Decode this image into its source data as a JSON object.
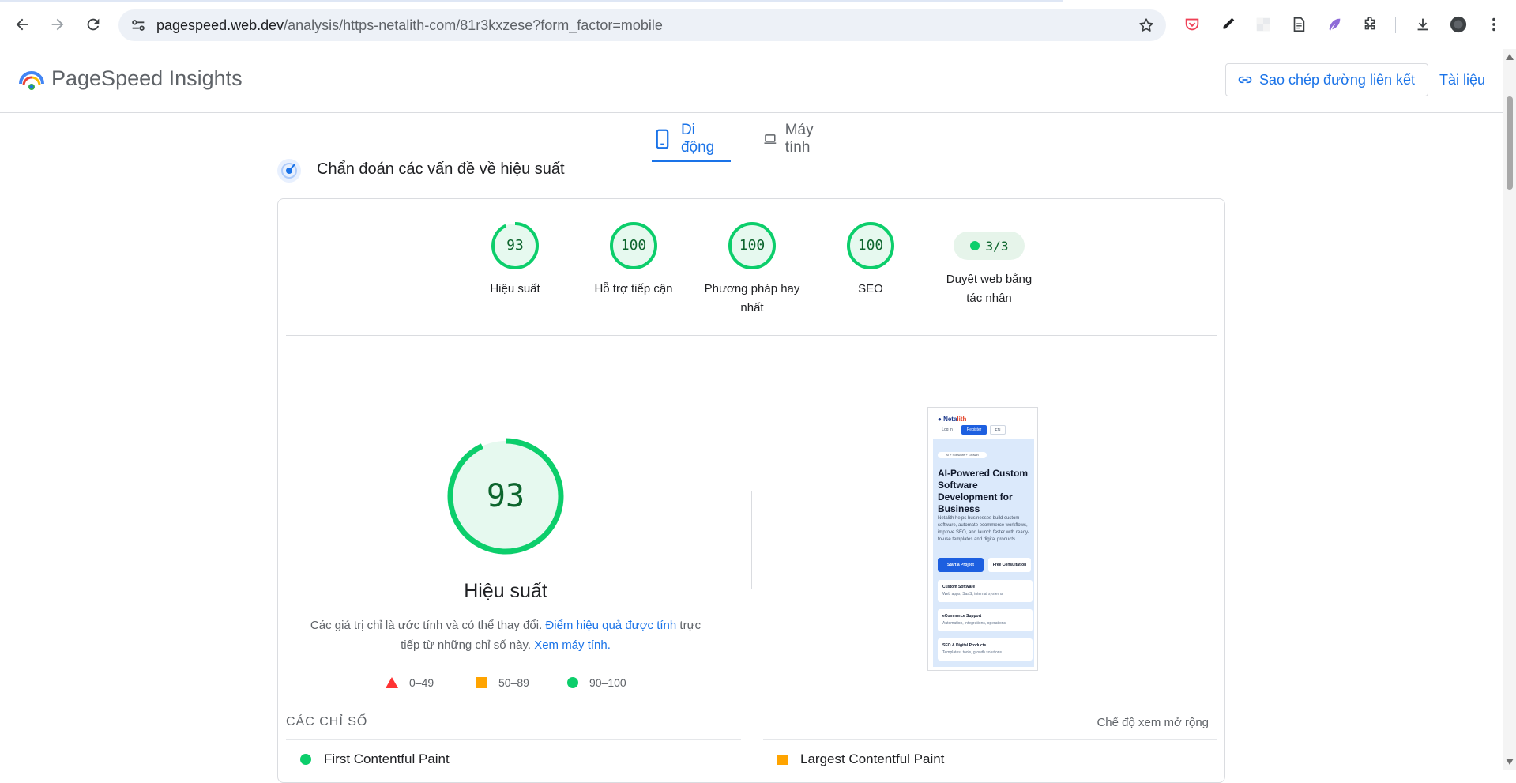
{
  "browser": {
    "url_host": "pagespeed.web.dev",
    "url_path": "/analysis/https-netalith-com/81r3kxzese?form_factor=mobile"
  },
  "header": {
    "title": "PageSpeed Insights",
    "copy_link_label": "Sao chép đường liên kết",
    "docs_label": "Tài liệu"
  },
  "device_tabs": {
    "mobile": "Di động",
    "desktop": "Máy tính"
  },
  "diagnose_title": "Chẩn đoán các vấn đề về hiệu suất",
  "scores": [
    {
      "value": "93",
      "label": "Hiệu suất"
    },
    {
      "value": "100",
      "label": "Hỗ trợ tiếp cận"
    },
    {
      "value": "100",
      "label": "Phương pháp hay nhất"
    },
    {
      "value": "100",
      "label": "SEO"
    }
  ],
  "agent": {
    "value": "3/3",
    "label": "Duyệt web bằng tác nhân"
  },
  "performance": {
    "score": "93",
    "title": "Hiệu suất",
    "disclaimer_1": "Các giá trị chỉ là ước tính và có thể thay đổi. ",
    "disclaimer_link_1": "Điểm hiệu quả được tính",
    "disclaimer_2": " trực tiếp từ những chỉ số này. ",
    "disclaimer_link_2": "Xem máy tính."
  },
  "legend": {
    "poor": "0–49",
    "average": "50–89",
    "good": "90–100"
  },
  "thumbnail": {
    "brand_1": "Neta",
    "brand_2": "lith",
    "login": "Log in",
    "register": "Register",
    "lang": "EN",
    "badge": "AI + Software + Growth",
    "headline": "AI-Powered Custom Software Development for Business",
    "body": "Netalith helps businesses build custom software, automate ecommerce workflows, improve SEO, and launch faster with ready-to-use templates and digital products.",
    "cta_primary": "Start a Project",
    "cta_secondary": "Free Consultation",
    "cards": [
      {
        "title": "Custom Software",
        "sub": "Web apps, SaaS, internal systems"
      },
      {
        "title": "eCommerce Support",
        "sub": "Automation, integrations, operations"
      },
      {
        "title": "SEO & Digital Products",
        "sub": "Templates, tools, growth solutions"
      }
    ]
  },
  "metrics": {
    "title": "CÁC CHỈ SỐ",
    "expand_label": "Chế độ xem mở rộng",
    "items": [
      "First Contentful Paint",
      "Largest Contentful Paint"
    ]
  },
  "colors": {
    "good": "#0cce6b",
    "average": "#ffa400",
    "poor": "#ff3333",
    "accent": "#1a73e8"
  }
}
